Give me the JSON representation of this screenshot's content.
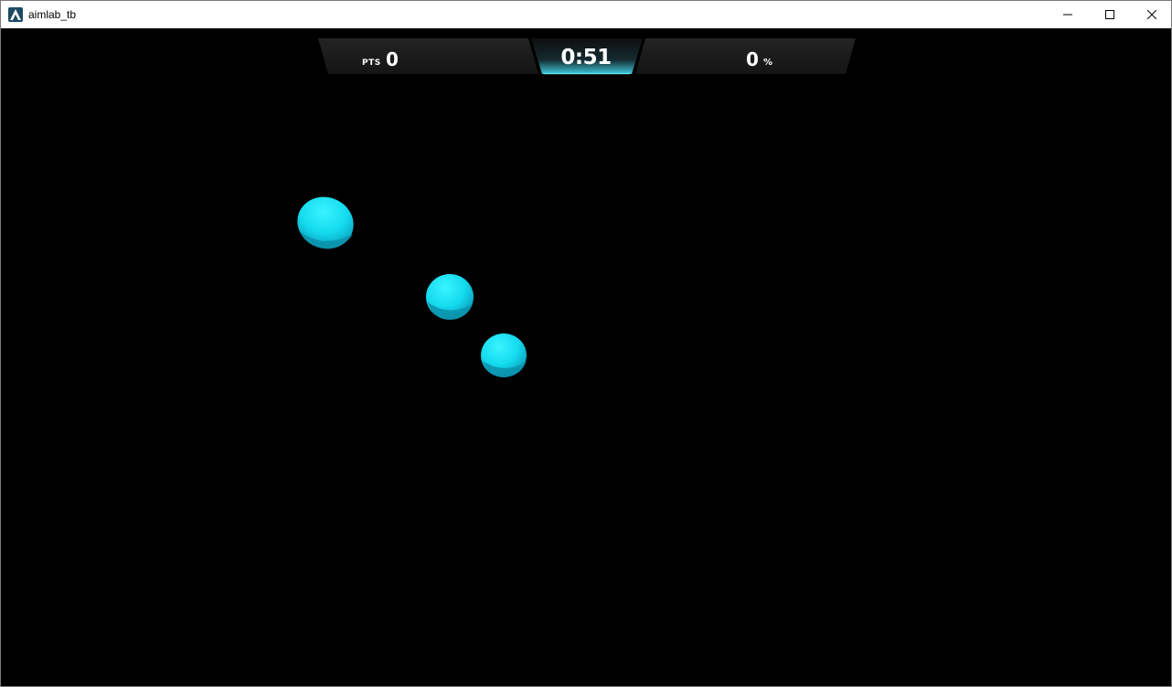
{
  "window": {
    "title": "aimlab_tb",
    "controls": {
      "minimize": "minimize-icon",
      "maximize": "maximize-icon",
      "close": "close-icon"
    }
  },
  "hud": {
    "points_label": "PTS",
    "points_value": "0",
    "timer": "0:51",
    "accuracy_value": "0",
    "accuracy_unit": "%"
  },
  "colors": {
    "target": "#16d9ee",
    "target_shadow": "#0a90a8",
    "hud_panel": "#1c1c1c",
    "timer_glow": "#4fd6e8",
    "background": "#000000"
  },
  "targets": [
    {
      "name": "target"
    },
    {
      "name": "target"
    },
    {
      "name": "target"
    }
  ]
}
